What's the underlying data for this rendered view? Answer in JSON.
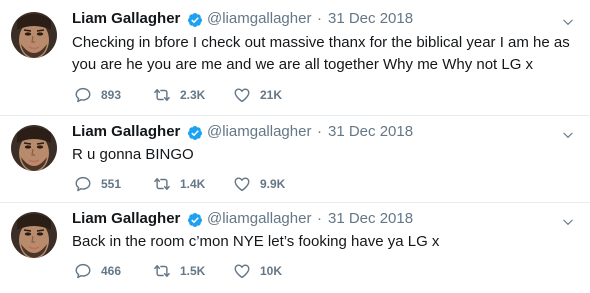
{
  "tweets": [
    {
      "name": "Liam Gallagher",
      "handle": "@liamgallagher",
      "separator": "·",
      "date": "31 Dec 2018",
      "text": "Checking in bfore I check out massive thanx for the biblical year I am he as you are he you are me and we are all together Why me Why not LG x",
      "replies": "893",
      "retweets": "2.3K",
      "likes": "21K"
    },
    {
      "name": "Liam Gallagher",
      "handle": "@liamgallagher",
      "separator": "·",
      "date": "31 Dec 2018",
      "text": "R u gonna BINGO",
      "replies": "551",
      "retweets": "1.4K",
      "likes": "9.9K"
    },
    {
      "name": "Liam Gallagher",
      "handle": "@liamgallagher",
      "separator": "·",
      "date": "31 Dec 2018",
      "text": "Back in the room c’mon NYE let’s fooking have ya LG x",
      "replies": "466",
      "retweets": "1.5K",
      "likes": "10K"
    }
  ],
  "colors": {
    "verified": "#1da1f2",
    "secondary_text": "#657786",
    "border": "#e6ecf0"
  },
  "icons": {
    "verified": "verified-badge-icon",
    "menu": "chevron-down-icon",
    "reply": "reply-icon",
    "retweet": "retweet-icon",
    "like": "heart-icon"
  }
}
